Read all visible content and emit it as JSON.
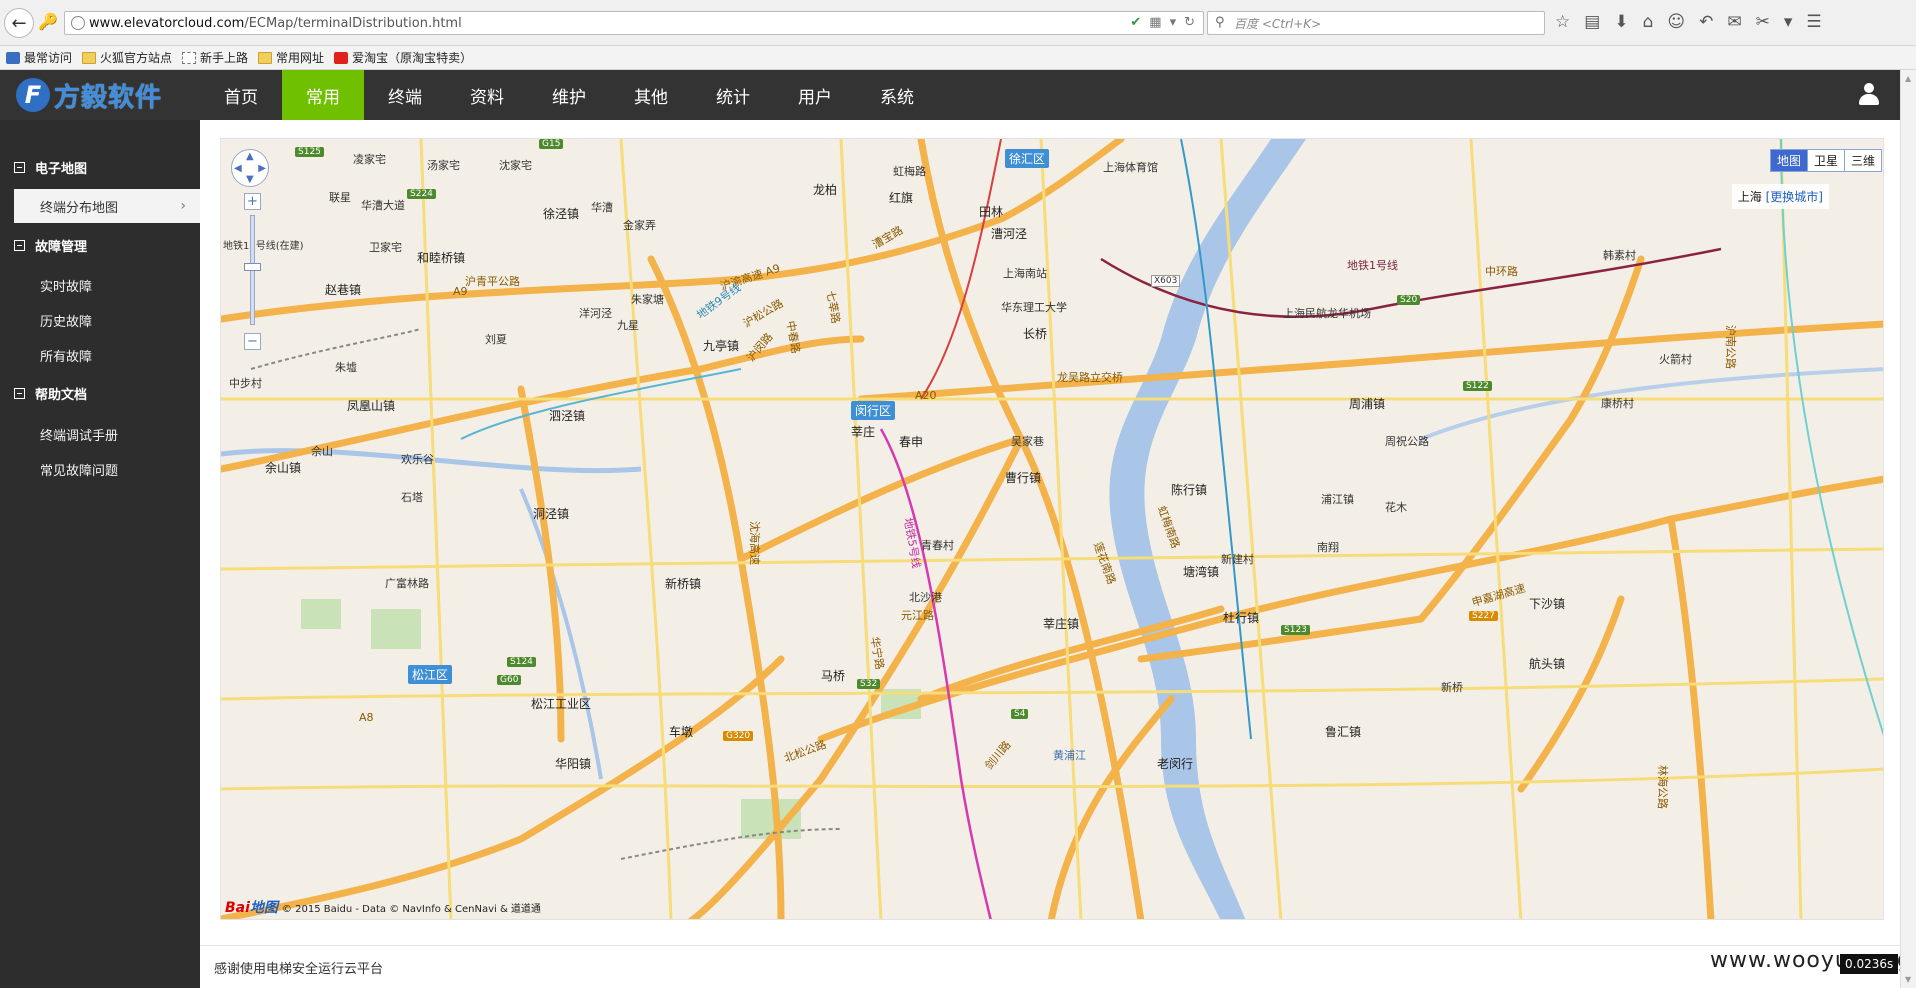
{
  "browser": {
    "url_host": "www.elevatorcloud.com",
    "url_path": "/ECMap/terminalDistribution.html",
    "search_placeholder": "百度 <Ctrl+K>",
    "bookmarks": [
      {
        "label": "最常访问",
        "icon": "blue"
      },
      {
        "label": "火狐官方站点",
        "icon": "folder"
      },
      {
        "label": "新手上路",
        "icon": "page"
      },
      {
        "label": "常用网址",
        "icon": "folder"
      },
      {
        "label": "爱淘宝（原淘宝特卖）",
        "icon": "taobao"
      }
    ]
  },
  "app": {
    "logo_text": "方毅软件",
    "logo_mark": "F",
    "nav": [
      "首页",
      "常用",
      "终端",
      "资料",
      "维护",
      "其他",
      "统计",
      "用户",
      "系统"
    ],
    "active_nav": "常用"
  },
  "sidebar": {
    "sections": [
      {
        "title": "电子地图",
        "items": [
          "终端分布地图"
        ]
      },
      {
        "title": "故障管理",
        "items": [
          "实时故障",
          "历史故障",
          "所有故障"
        ]
      },
      {
        "title": "帮助文档",
        "items": [
          "终端调试手册",
          "常见故障问题"
        ]
      }
    ],
    "active_item": "终端分布地图"
  },
  "map": {
    "type_buttons": [
      "地图",
      "卫星",
      "三维"
    ],
    "selected_type": "地图",
    "city": "上海",
    "change_city": "[更换城市]",
    "copyright": "© 2015 Baidu - Data © NavInfo & CenNavi & 道道通",
    "baidu_logo": "Bai",
    "baidu_logo_tail": "地图",
    "zoom_in": "+",
    "zoom_out": "−",
    "districts": [
      "徐汇区",
      "闵行区",
      "松江区"
    ],
    "towns": [
      "凌家宅",
      "汤家宅",
      "沈家宅",
      "联星",
      "华漕大道",
      "徐泾镇",
      "金家弄",
      "和睦桥镇",
      "卫家宅",
      "赵巷镇",
      "九亭镇",
      "九星",
      "朱家塘",
      "洋河泾",
      "刘夏",
      "中步村",
      "朱墟",
      "凤凰山镇",
      "泗泾镇",
      "华漕",
      "龙柏",
      "红旗",
      "虹梅路",
      "田林",
      "漕河泾",
      "上海南站",
      "华东理工大学",
      "长桥",
      "莘庄",
      "春申",
      "吴家巷",
      "曹行镇",
      "陈行镇",
      "周浦镇",
      "周祝公路",
      "新桥镇",
      "佘山",
      "余山镇",
      "欢乐谷",
      "石塔",
      "洞泾镇",
      "广富林路",
      "车墩",
      "松江工业区",
      "华阳镇",
      "马桥",
      "下沙镇",
      "航头镇",
      "鲁汇镇",
      "杜行镇",
      "韩素村",
      "火箭村",
      "康桥村",
      "上海体育馆",
      "上海民航龙华机场",
      "花木",
      "南翔",
      "塘湾镇",
      "莘庄镇",
      "老闵行",
      "新建村",
      "北沙港",
      "青春村",
      "新桥",
      "浦江镇"
    ],
    "roads": [
      "沪渝高速 A9",
      "A9",
      "沪青平公路",
      "沪松公路",
      "沈海高速",
      "A20",
      "龙吴路立交桥",
      "申嘉湖高速",
      "中环路",
      "S20",
      "G60",
      "A8",
      "S32",
      "S4",
      "S124",
      "S224",
      "S125",
      "S122",
      "S123",
      "S227",
      "G15",
      "G320",
      "X603",
      "地铁9号线",
      "地铁5号线",
      "地铁1号线",
      "地铁17号线(在建)",
      "黄浦江",
      "林海公路",
      "沪南公路",
      "沪闵路",
      "元江路",
      "北松公路",
      "剑川路",
      "莲花南路",
      "虹梅南路",
      "漕宝路",
      "中春路",
      "七莘路",
      "华宁路"
    ]
  },
  "footer": {
    "text": "感谢使用电梯安全运行云平台",
    "watermark": "www.wooyun.org",
    "timer": "0.0236s"
  },
  "colors": {
    "header_bg": "#333333",
    "active_nav": "#6fc100",
    "sidebar_bg": "#2d2d2d",
    "map_bg": "#f4efe6",
    "highway": "#f3b24a",
    "water": "#a9c5e8"
  }
}
